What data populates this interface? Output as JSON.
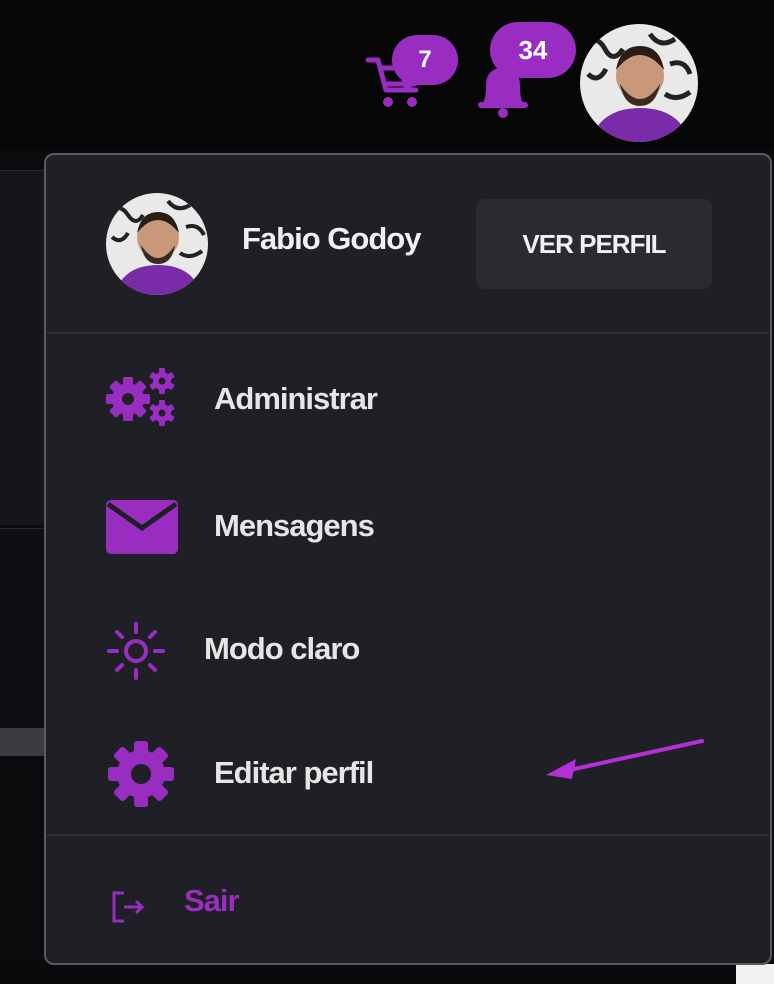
{
  "colors": {
    "accent": "#9a2dc1",
    "menu_bg": "#1f2025",
    "page_bg": "#0b0b0d",
    "text": "#f1f1f1"
  },
  "header": {
    "cart": {
      "icon": "cart-icon",
      "count": "7"
    },
    "notifications": {
      "icon": "bell-icon",
      "count": "34"
    },
    "avatar": "user-avatar"
  },
  "menu": {
    "profile": {
      "name": "Fabio Godoy",
      "view_profile_label": "VER PERFIL"
    },
    "items": [
      {
        "icon": "gears-icon",
        "label": "Administrar"
      },
      {
        "icon": "envelope-icon",
        "label": "Mensagens"
      },
      {
        "icon": "sun-icon",
        "label": "Modo claro"
      },
      {
        "icon": "gear-icon",
        "label": "Editar perfil"
      }
    ],
    "logout": {
      "icon": "logout-icon",
      "label": "Sair"
    }
  }
}
